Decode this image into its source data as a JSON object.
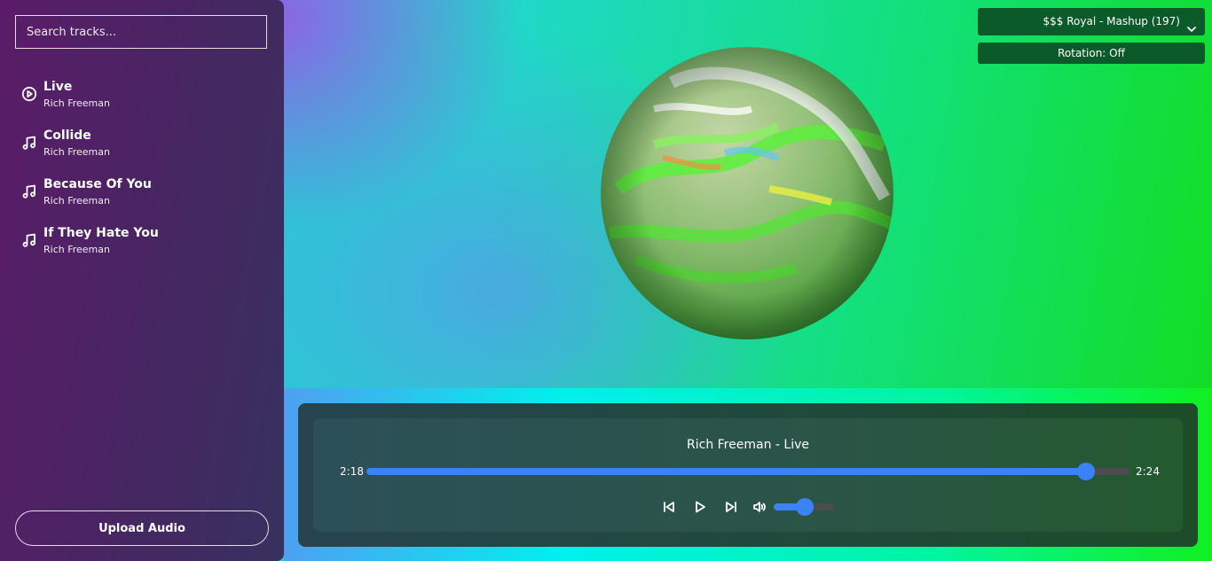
{
  "sidebar": {
    "search": {
      "placeholder": "Search tracks..."
    },
    "tracks": [
      {
        "title": "Live",
        "artist": "Rich Freeman",
        "icon": "play-circle-icon"
      },
      {
        "title": "Collide",
        "artist": "Rich Freeman",
        "icon": "music-note-icon"
      },
      {
        "title": "Because Of You",
        "artist": "Rich Freeman",
        "icon": "music-note-icon"
      },
      {
        "title": "If They Hate You",
        "artist": "Rich Freeman",
        "icon": "music-note-icon"
      }
    ],
    "upload_label": "Upload Audio"
  },
  "controls": {
    "preset_label": "$$$ Royal - Mashup (197)",
    "rotation_label": "Rotation: Off"
  },
  "player": {
    "now_playing": "Rich Freeman - Live",
    "current_time": "2:18",
    "duration": "2:24",
    "progress_fraction": 0.943,
    "volume_fraction": 0.52
  },
  "colors": {
    "accent": "#3b82f6",
    "sidebar": "#4a2462",
    "panel_button": "#0a5a2a"
  }
}
